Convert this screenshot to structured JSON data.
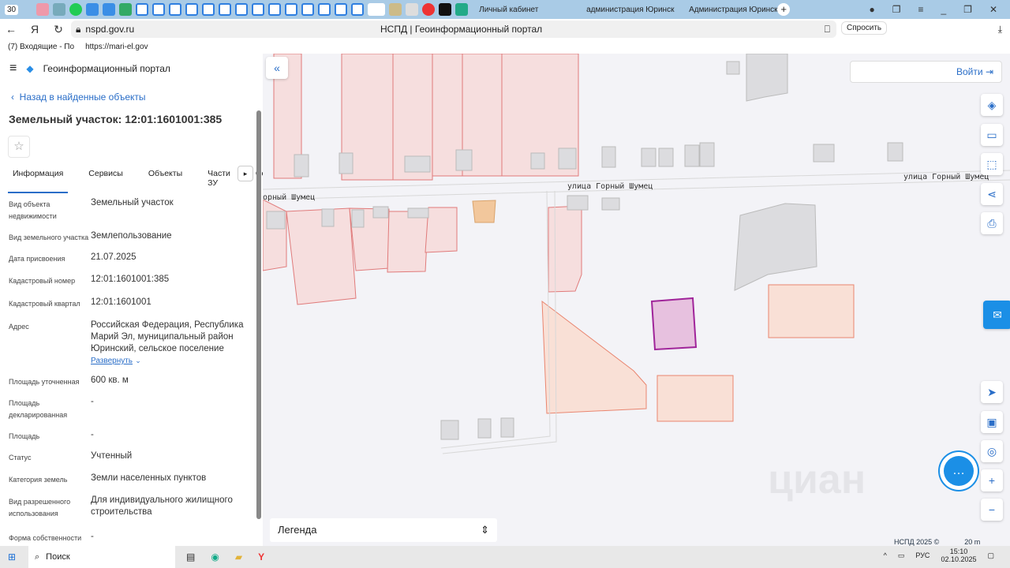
{
  "browser": {
    "tab_count": "30",
    "tabs": [
      {
        "label": "Личный кабинет"
      },
      {
        "label": "администрация Юринск"
      },
      {
        "label": "Администрация Юринск"
      }
    ],
    "url": "nspd.gov.ru",
    "page_title": "НСПД | Геоинформационный портал",
    "ask_label": "Спросить",
    "bookmarks": [
      "(7) Входящие - По",
      "https://mari-el.gov"
    ]
  },
  "app": {
    "title": "Геоинформационный портал",
    "back_label": "Назад в найденные объекты",
    "object_title": "Земельный участок: 12:01:1601001:385",
    "tabs": [
      "Информация",
      "Сервисы",
      "Объекты",
      "Части ЗУ",
      "Соста"
    ],
    "fields": [
      {
        "k": "Вид объекта недвижимости",
        "v": "Земельный участок"
      },
      {
        "k": "Вид земельного участка",
        "v": "Землепользование"
      },
      {
        "k": "Дата присвоения",
        "v": "21.07.2025"
      },
      {
        "k": "Кадастровый номер",
        "v": "12:01:1601001:385"
      },
      {
        "k": "Кадастровый квартал",
        "v": "12:01:1601001"
      },
      {
        "k": "Адрес",
        "v": "Российская Федерация, Республика Марий Эл, муниципальный район Юринский, сельское поселение"
      },
      {
        "k": "Площадь уточненная",
        "v": "600 кв. м"
      },
      {
        "k": "Площадь декларированная",
        "v": "-"
      },
      {
        "k": "Площадь",
        "v": "-"
      },
      {
        "k": "Статус",
        "v": "Учтенный"
      },
      {
        "k": "Категория земель",
        "v": "Земли населенных пунктов"
      },
      {
        "k": "Вид разрешенного использования",
        "v": "Для индивидуального жилищного строительства"
      },
      {
        "k": "Форма собственности",
        "v": "-"
      }
    ],
    "expand_label": "Развернуть"
  },
  "map": {
    "login_label": "Войти",
    "legend_label": "Легенда",
    "street1": "улица Горный Шумец",
    "street2": "улица Горный Шумец",
    "street3": "орный Шумец",
    "copyright": "НСПД 2025 ©",
    "scale": "20 m",
    "watermark": "циан"
  },
  "taskbar": {
    "search_label": "Поиск",
    "lang": "РУС",
    "time": "15:10",
    "date": "02.10.2025"
  }
}
